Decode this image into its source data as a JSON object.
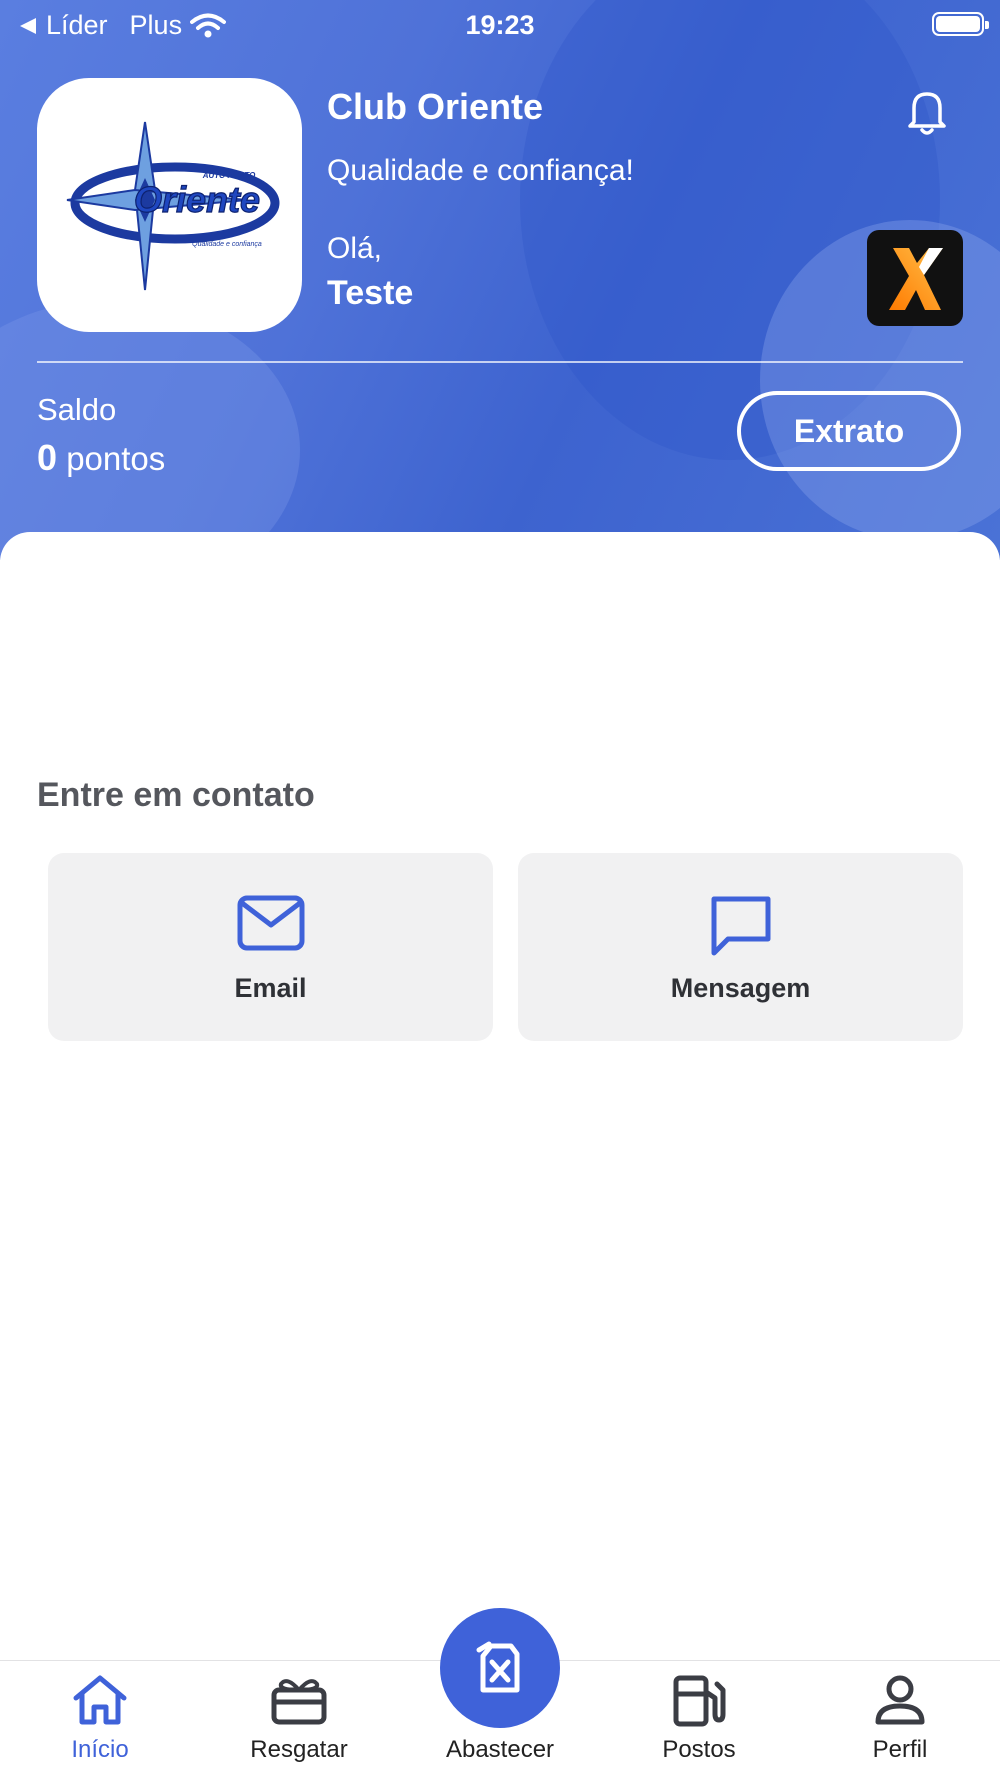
{
  "status_bar": {
    "back_label": "Líder",
    "carrier": "Plus",
    "time": "19:23"
  },
  "header": {
    "club_name": "Club Oriente",
    "slogan": "Qualidade e confiança!",
    "greeting": "Olá,",
    "user_name": "Teste",
    "logo_text": "Oriente",
    "logo_top_text": "AUTO POSTO",
    "logo_tagline": "Qualidade e confiança"
  },
  "balance": {
    "label": "Saldo",
    "points": "0",
    "unit": "pontos",
    "statement_button": "Extrato"
  },
  "contact": {
    "title": "Entre em contato",
    "options": [
      {
        "label": "Email",
        "icon": "mail-icon"
      },
      {
        "label": "Mensagem",
        "icon": "message-icon"
      }
    ]
  },
  "tabs": [
    {
      "label": "Início",
      "icon": "home-icon",
      "active": true
    },
    {
      "label": "Resgatar",
      "icon": "gift-icon",
      "active": false
    },
    {
      "label": "Abastecer",
      "icon": "fuel-can-icon",
      "active": false
    },
    {
      "label": "Postos",
      "icon": "gas-station-icon",
      "active": false
    },
    {
      "label": "Perfil",
      "icon": "user-icon",
      "active": false
    }
  ],
  "colors": {
    "primary": "#3f62d9",
    "active_tab": "#3f62d9",
    "card_bg": "#f1f1f2",
    "title_text": "#55575d"
  }
}
